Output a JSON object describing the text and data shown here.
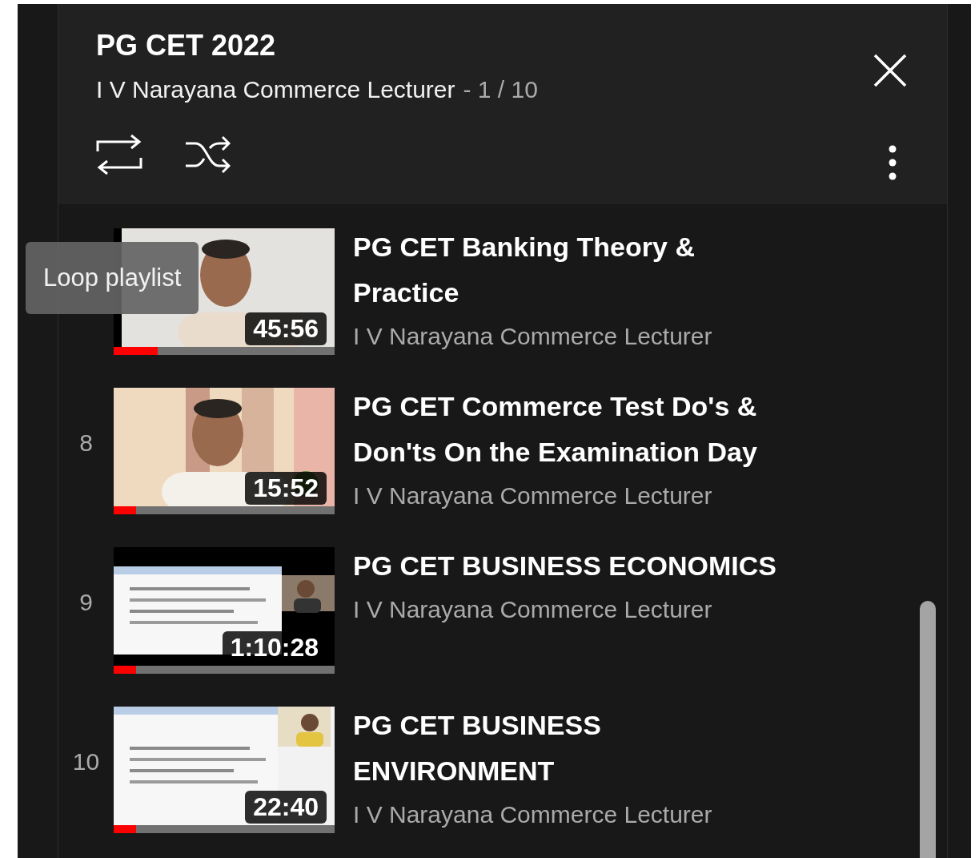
{
  "playlist": {
    "title": "PG CET 2022",
    "owner": "I V Narayana Commerce Lecturer",
    "position": "- 1 / 10"
  },
  "tooltip": {
    "text": "Loop playlist"
  },
  "videos": [
    {
      "title": "PG CET Banking Theory & Practice",
      "channel": "I V Narayana Commerce Lecturer",
      "duration": "45:56",
      "level": 0.2
    },
    {
      "index": "8",
      "title": "PG CET Commerce Test Do's & Don'ts On the Examination Day",
      "channel": "I V Narayana Commerce Lecturer",
      "duration": "15:52",
      "level": 0.1
    },
    {
      "index": "9",
      "title": "PG CET BUSINESS ECONOMICS",
      "channel": "I V Narayana Commerce Lecturer",
      "duration": "1:10:28",
      "level": 0.1
    },
    {
      "index": "10",
      "title": "PG CET BUSINESS ENVIRONMENT",
      "channel": "I V Narayana Commerce Lecturer",
      "duration": "22:40",
      "level": 0.1
    }
  ]
}
